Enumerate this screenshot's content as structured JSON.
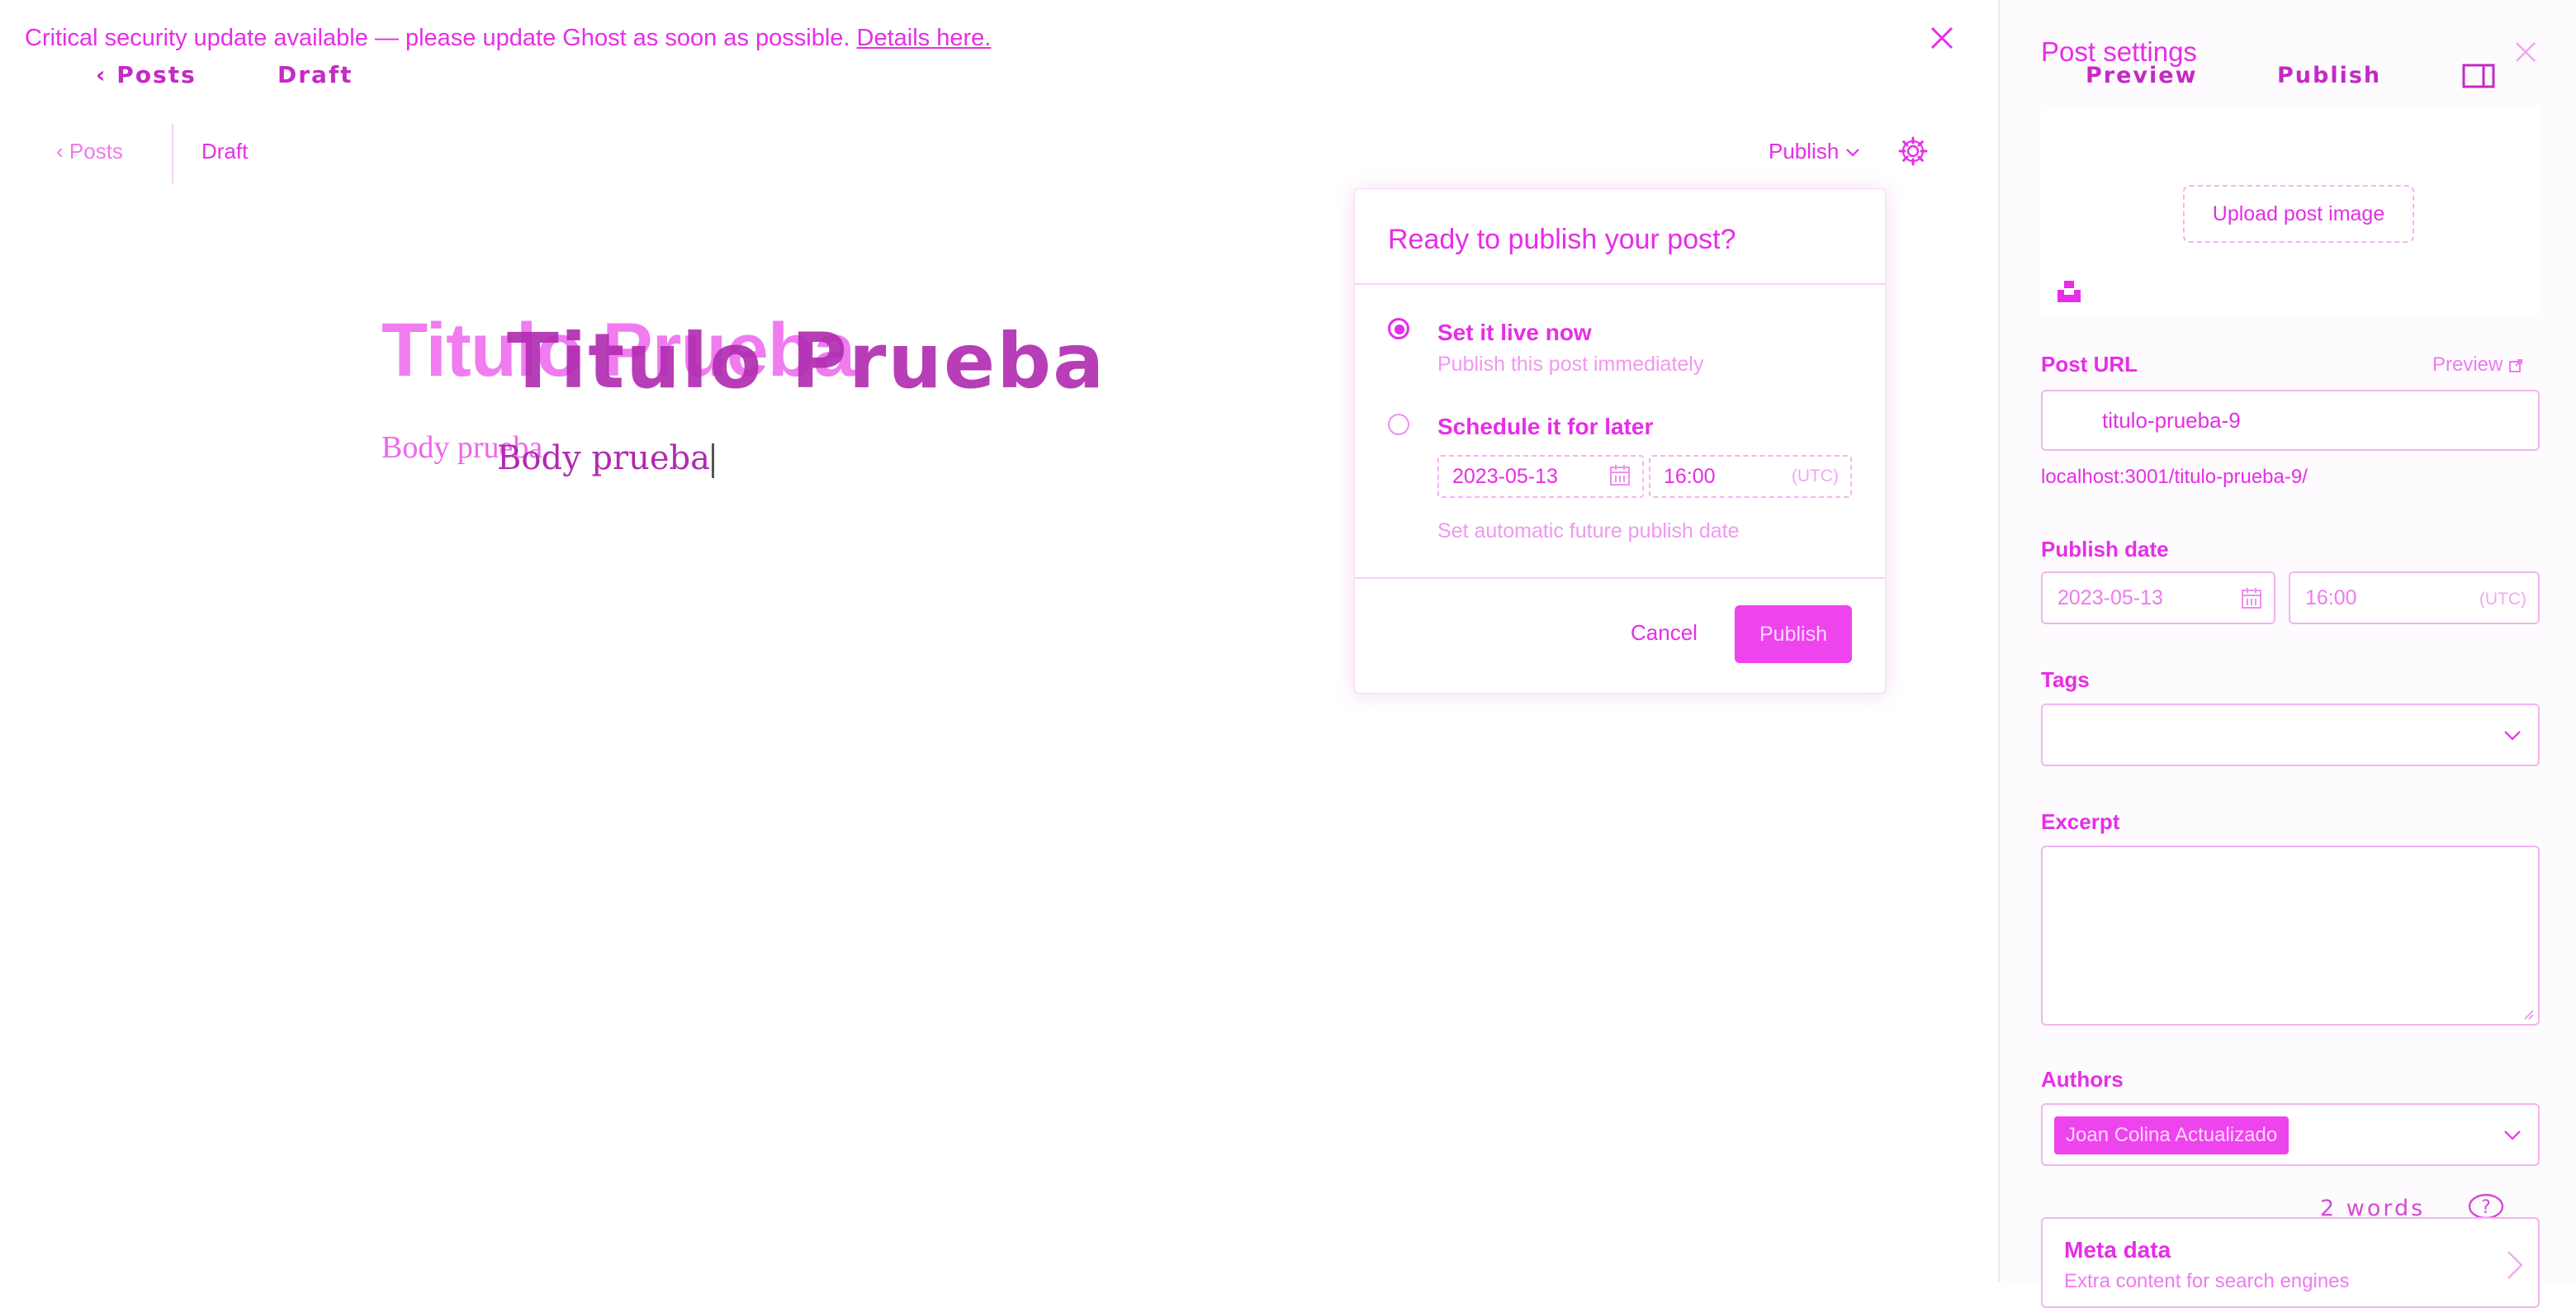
{
  "banner": {
    "text": "Critical security update available — please update Ghost as soon as possible.",
    "link": "Details here."
  },
  "ghost_header": {
    "posts": "Posts",
    "draft": "Draft"
  },
  "editor_header": {
    "posts": "Posts",
    "draft": "Draft",
    "publish": "Publish"
  },
  "editor": {
    "title": "Titulo Prueba",
    "body": "Body prueba"
  },
  "publish_popover": {
    "title": "Ready to publish your post?",
    "options": [
      {
        "label": "Set it live now",
        "description": "Publish this post immediately",
        "selected": true
      },
      {
        "label": "Schedule it for later",
        "description": "Set automatic future publish date",
        "selected": false
      }
    ],
    "date": "2023-05-13",
    "time": "16:00",
    "timezone": "(UTC)",
    "cancel": "Cancel",
    "publish": "Publish"
  },
  "sidebar": {
    "title": "Post settings",
    "ghost_preview": "Preview",
    "ghost_publish": "Publish",
    "upload_image": "Upload post image",
    "post_url_label": "Post URL",
    "preview_link": "Preview",
    "post_url_value": "titulo-prueba-9",
    "post_url_full": "localhost:3001/titulo-prueba-9/",
    "publish_date_label": "Publish date",
    "publish_date": "2023-05-13",
    "publish_time": "16:00",
    "timezone": "(UTC)",
    "tags_label": "Tags",
    "excerpt_label": "Excerpt",
    "authors_label": "Authors",
    "author": "Joan Colina Actualizado",
    "word_count": "2 words",
    "meta_title": "Meta data",
    "meta_subtitle": "Extra content for search engines"
  },
  "colors": {
    "accent": "#e62ee6",
    "border": "#f1b4f1",
    "button": "#ee44ee"
  }
}
